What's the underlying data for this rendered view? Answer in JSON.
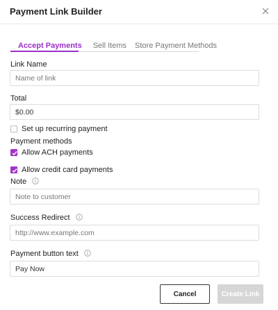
{
  "dialog": {
    "title": "Payment Link Builder",
    "close_icon": "close-icon"
  },
  "tabs": [
    {
      "label": "Accept Payments",
      "active": true
    },
    {
      "label": "Sell Items",
      "active": false
    },
    {
      "label": "Store Payment Methods",
      "active": false
    }
  ],
  "form": {
    "link_name": {
      "label": "Link Name",
      "value": "",
      "placeholder": "Name of link"
    },
    "total": {
      "label": "Total",
      "value": "$0.00",
      "placeholder": ""
    },
    "recurring": {
      "label": "Set up recurring payment",
      "checked": false
    },
    "payment_methods_label": "Payment methods",
    "ach": {
      "label": "Allow ACH payments",
      "checked": true
    },
    "credit_card": {
      "label": "Allow credit card payments",
      "checked": true
    },
    "note": {
      "label": "Note",
      "value": "",
      "placeholder": "Note to customer",
      "icon": "info-icon"
    },
    "success_redirect": {
      "label": "Success Redirect",
      "value": "",
      "placeholder": "http://www.example.com",
      "icon": "info-icon"
    },
    "button_text": {
      "label": "Payment button text",
      "value": "Pay Now",
      "placeholder": "",
      "icon": "info-icon"
    }
  },
  "actions": {
    "cancel_label": "Cancel",
    "create_label": "Create Link"
  },
  "colors": {
    "accent": "#9b30c9",
    "disabled_button": "#d6d6d6"
  }
}
